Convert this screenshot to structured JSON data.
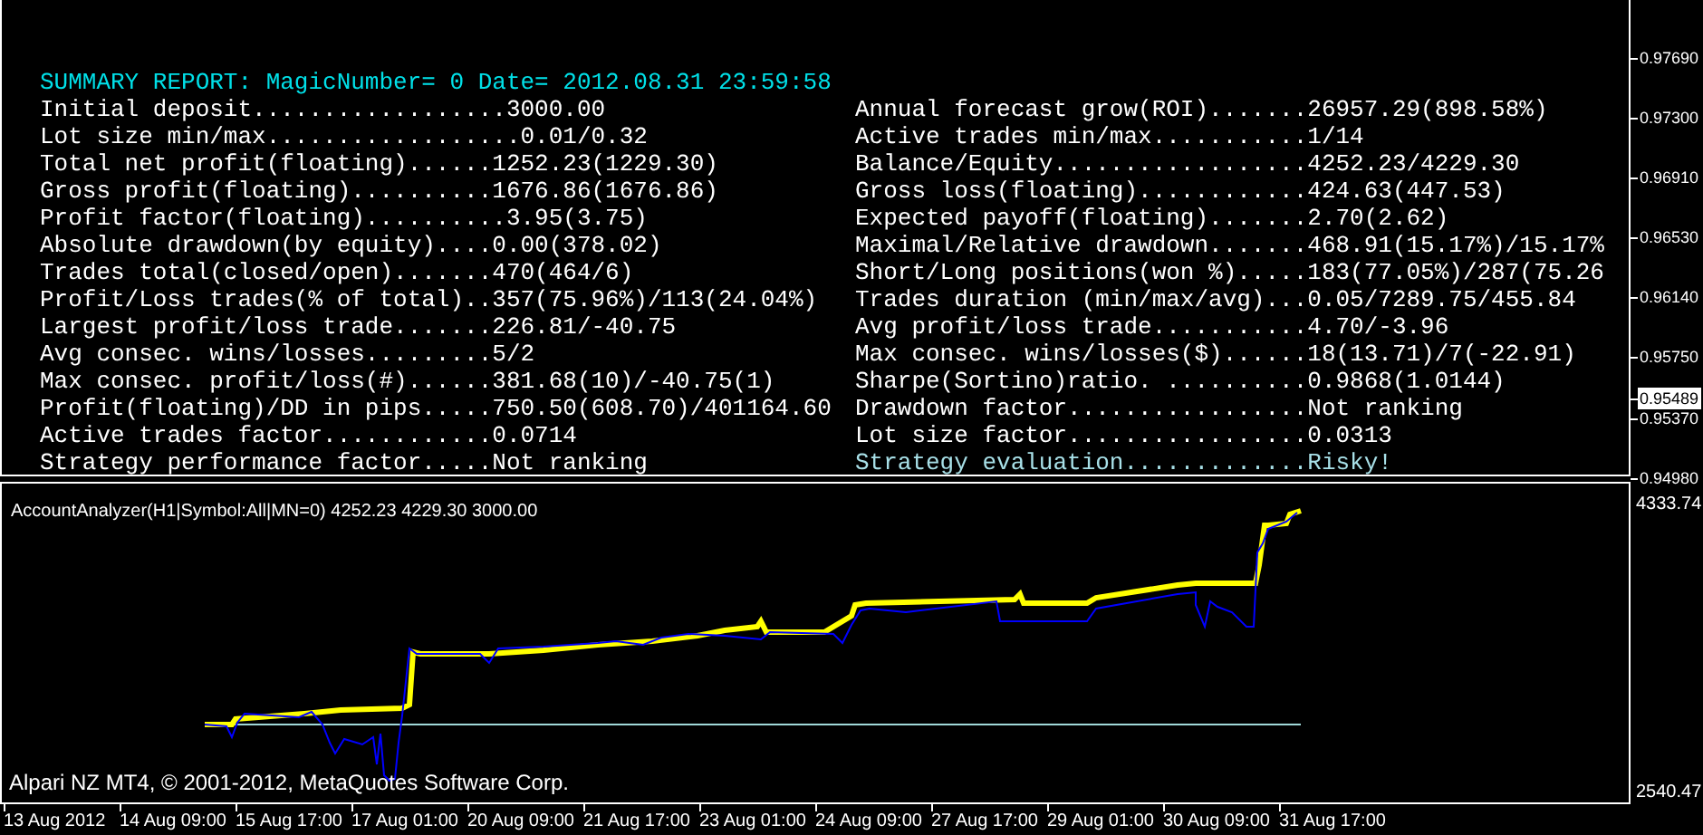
{
  "report": {
    "header": "SUMMARY REPORT: MagicNumber= 0 Date= 2012.08.31 23:59:58",
    "left": [
      {
        "label": "Initial deposit..................",
        "value": "3000.00",
        "kind": "normal"
      },
      {
        "label": "Lot size min/max..................",
        "value": "0.01/0.32",
        "kind": "normal"
      },
      {
        "label": "Total net profit(floating)......",
        "value": "1252.23(1229.30)",
        "kind": "normal"
      },
      {
        "label": "Gross profit(floating)..........",
        "value": "1676.86(1676.86)",
        "kind": "normal"
      },
      {
        "label": "Profit factor(floating)..........",
        "value": "3.95(3.75)",
        "kind": "normal"
      },
      {
        "label": "Absolute drawdown(by equity)....",
        "value": "0.00(378.02)",
        "kind": "normal"
      },
      {
        "label": "Trades total(closed/open).......",
        "value": "470(464/6)",
        "kind": "normal"
      },
      {
        "label": "Profit/Loss trades(% of total)..",
        "value": "357(75.96%)/113(24.04%)",
        "kind": "normal"
      },
      {
        "label": "Largest profit/loss trade.......",
        "value": "226.81/-40.75",
        "kind": "normal"
      },
      {
        "label": "Avg consec. wins/losses.........",
        "value": "5/2",
        "kind": "normal"
      },
      {
        "label": "Max consec. profit/loss(#)......",
        "value": "381.68(10)/-40.75(1)",
        "kind": "normal"
      },
      {
        "label": "Profit(floating)/DD in pips.....",
        "value": "750.50(608.70)/401164.60",
        "kind": "normal"
      },
      {
        "label": "Active trades factor............",
        "value": "0.0714",
        "kind": "normal"
      },
      {
        "label": "Strategy performance factor.....",
        "value": "Not ranking",
        "kind": "normal"
      }
    ],
    "right": [
      {
        "label": "Annual forecast grow(ROI).......",
        "value": "26957.29(898.58%)",
        "kind": "normal"
      },
      {
        "label": "Active trades min/max...........",
        "value": "1/14",
        "kind": "normal"
      },
      {
        "label": "Balance/Equity..................",
        "value": "4252.23/4229.30",
        "kind": "normal"
      },
      {
        "label": "Gross loss(floating)............",
        "value": "424.63(447.53)",
        "kind": "normal"
      },
      {
        "label": "Expected payoff(floating).......",
        "value": "2.70(2.62)",
        "kind": "normal"
      },
      {
        "label": "Maximal/Relative drawdown.......",
        "value": "468.91(15.17%)/15.17%",
        "kind": "normal"
      },
      {
        "label": "Short/Long positions(won %).....",
        "value": "183(77.05%)/287(75.26",
        "kind": "normal"
      },
      {
        "label": "Trades duration (min/max/avg)...",
        "value": "0.05/7289.75/455.84",
        "kind": "normal"
      },
      {
        "label": "Avg profit/loss trade...........",
        "value": "4.70/-3.96",
        "kind": "normal"
      },
      {
        "label": "Max consec. wins/losses($)......",
        "value": "18(13.71)/7(-22.91)",
        "kind": "normal"
      },
      {
        "label": "Sharpe(Sortino)ratio. ..........",
        "value": "0.9868(1.0144)",
        "kind": "normal"
      },
      {
        "label": "Drawdown factor.................",
        "value": "Not ranking",
        "kind": "normal"
      },
      {
        "label": "Lot size factor.................",
        "value": "0.0313",
        "kind": "normal"
      },
      {
        "label": "Strategy evaluation.............",
        "value": "Risky!",
        "kind": "highlight"
      }
    ]
  },
  "price_axis": [
    {
      "label": "0.97690",
      "kind": "tick"
    },
    {
      "label": "0.97300",
      "kind": "tick"
    },
    {
      "label": "0.96910",
      "kind": "tick"
    },
    {
      "label": "0.96530",
      "kind": "tick"
    },
    {
      "label": "0.96140",
      "kind": "tick"
    },
    {
      "label": "0.95750",
      "kind": "tick"
    },
    {
      "label": "0.95489",
      "kind": "current"
    },
    {
      "label": "0.95370",
      "kind": "tick"
    },
    {
      "label": "0.94980",
      "kind": "tick"
    }
  ],
  "indicator": {
    "title": "AccountAnalyzer(H1|Symbol:All|MN=0) 4252.23 4229.30 3000.00",
    "copyright": "Alpari NZ MT4, © 2001-2012, MetaQuotes Software Corp.",
    "axis": [
      "4333.74",
      "2540.47"
    ]
  },
  "time_axis": [
    "13 Aug 2012",
    "14 Aug 09:00",
    "15 Aug 17:00",
    "17 Aug 01:00",
    "20 Aug 09:00",
    "21 Aug 17:00",
    "23 Aug 01:00",
    "24 Aug 09:00",
    "27 Aug 17:00",
    "29 Aug 01:00",
    "30 Aug 09:00",
    "31 Aug 17:00"
  ]
}
